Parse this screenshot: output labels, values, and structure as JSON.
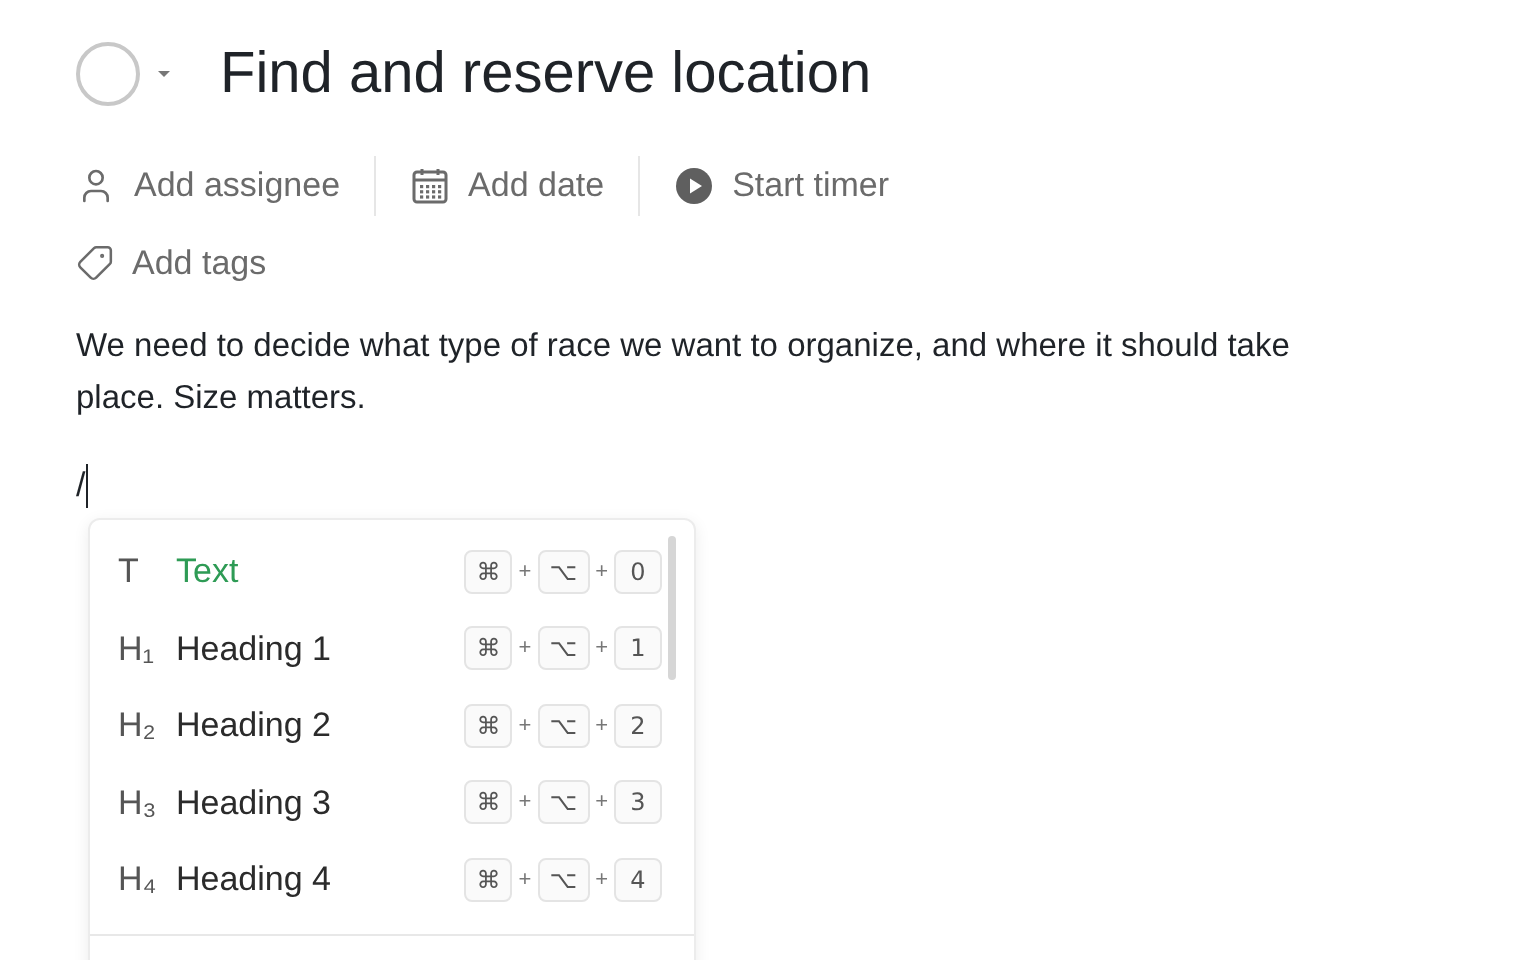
{
  "task": {
    "title": "Find and reserve location",
    "completed": false
  },
  "actions": [
    {
      "kind": "assignee",
      "label": "Add assignee"
    },
    {
      "kind": "date",
      "label": "Add date"
    },
    {
      "kind": "timer",
      "label": "Start timer"
    }
  ],
  "tags": {
    "label": "Add tags"
  },
  "description": "We need to decide what type of race we want to organize, and where it should take place. Size matters.",
  "editor_input": "/",
  "menu": {
    "items": [
      {
        "glyph": "T",
        "label": "Text",
        "keys": [
          "⌘",
          "⌥",
          "0"
        ],
        "selected": true
      },
      {
        "glyph": "H₁",
        "label": "Heading 1",
        "keys": [
          "⌘",
          "⌥",
          "1"
        ],
        "selected": false
      },
      {
        "glyph": "H₂",
        "label": "Heading 2",
        "keys": [
          "⌘",
          "⌥",
          "2"
        ],
        "selected": false
      },
      {
        "glyph": "H₃",
        "label": "Heading 3",
        "keys": [
          "⌘",
          "⌥",
          "3"
        ],
        "selected": false
      },
      {
        "glyph": "H₄",
        "label": "Heading 4",
        "keys": [
          "⌘",
          "⌥",
          "4"
        ],
        "selected": false
      }
    ],
    "separator": "+"
  }
}
